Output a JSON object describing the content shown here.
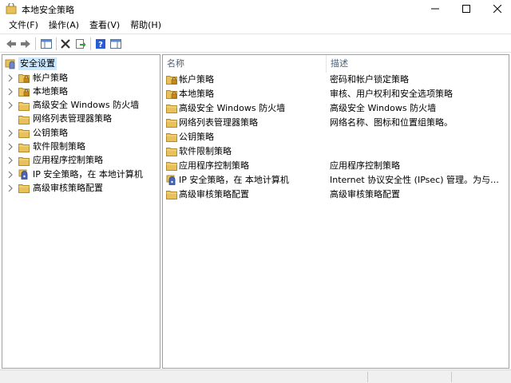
{
  "window": {
    "title": "本地安全策略",
    "icon": "security-policy-icon"
  },
  "menu": {
    "items": [
      "文件(F)",
      "操作(A)",
      "查看(V)",
      "帮助(H)"
    ]
  },
  "toolbar": {
    "icons": [
      "back-arrow-icon",
      "forward-arrow-icon",
      "show-hide-tree-icon",
      "delete-icon",
      "export-list-icon",
      "help-icon",
      "action-pane-icon"
    ]
  },
  "tree": {
    "root": "安全设置",
    "items": [
      {
        "label": "帐户策略",
        "icon": "folder-lock-icon",
        "expandable": true
      },
      {
        "label": "本地策略",
        "icon": "folder-lock-icon",
        "expandable": true
      },
      {
        "label": "高级安全 Windows 防火墙",
        "icon": "folder-icon",
        "expandable": true
      },
      {
        "label": "网络列表管理器策略",
        "icon": "folder-icon",
        "expandable": false
      },
      {
        "label": "公钥策略",
        "icon": "folder-icon",
        "expandable": true
      },
      {
        "label": "软件限制策略",
        "icon": "folder-icon",
        "expandable": true
      },
      {
        "label": "应用程序控制策略",
        "icon": "folder-icon",
        "expandable": true
      },
      {
        "label": "IP 安全策略，在 本地计算机",
        "icon": "ip-security-icon",
        "expandable": true
      },
      {
        "label": "高级审核策略配置",
        "icon": "folder-icon",
        "expandable": true
      }
    ]
  },
  "list": {
    "columns": {
      "name": "名称",
      "description": "描述"
    },
    "rows": [
      {
        "name": "帐户策略",
        "description": "密码和帐户锁定策略",
        "icon": "folder-lock-icon"
      },
      {
        "name": "本地策略",
        "description": "审核、用户权利和安全选项策略",
        "icon": "folder-lock-icon"
      },
      {
        "name": "高级安全 Windows 防火墙",
        "description": "高级安全 Windows 防火墙",
        "icon": "folder-icon"
      },
      {
        "name": "网络列表管理器策略",
        "description": "网络名称、图标和位置组策略。",
        "icon": "folder-icon"
      },
      {
        "name": "公钥策略",
        "description": "",
        "icon": "folder-icon"
      },
      {
        "name": "软件限制策略",
        "description": "",
        "icon": "folder-icon"
      },
      {
        "name": "应用程序控制策略",
        "description": "应用程序控制策略",
        "icon": "folder-icon"
      },
      {
        "name": "IP 安全策略，在 本地计算机",
        "description": "Internet 协议安全性 (IPsec) 管理。为与别的...",
        "icon": "ip-security-icon"
      },
      {
        "name": "高级审核策略配置",
        "description": "高级审核策略配置",
        "icon": "folder-icon"
      }
    ]
  },
  "colors": {
    "selection": "#cce8ff",
    "header_text": "#4c607a",
    "folder": "#e8c15a",
    "border": "#a0a0a0"
  }
}
